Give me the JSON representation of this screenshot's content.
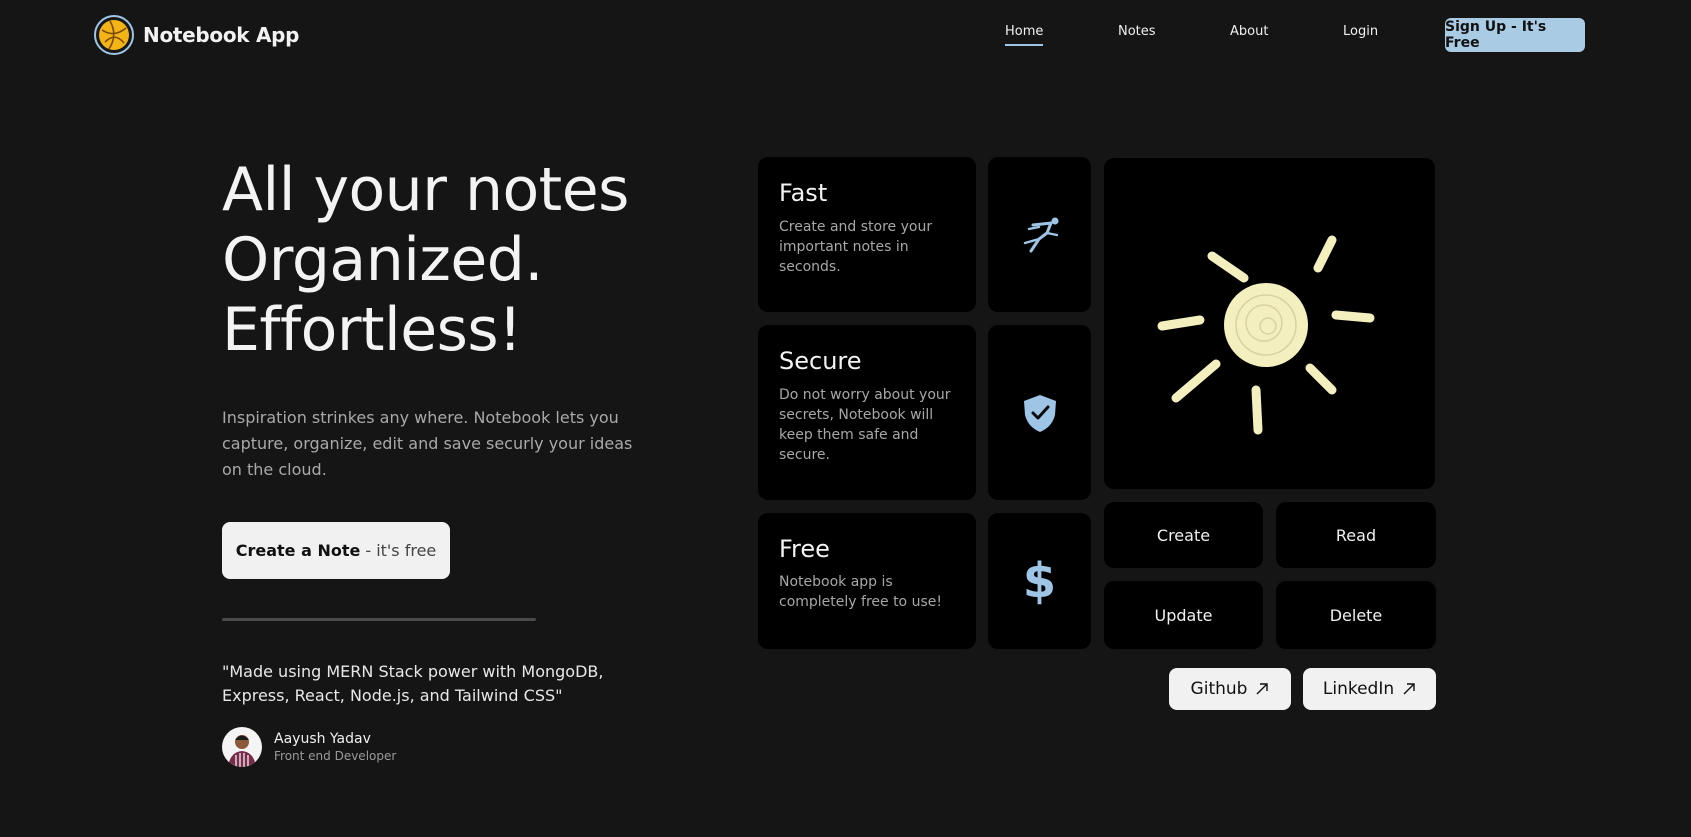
{
  "app": {
    "name": "Notebook App"
  },
  "nav": {
    "items": [
      {
        "label": "Home",
        "active": true
      },
      {
        "label": "Notes",
        "active": false
      },
      {
        "label": "About",
        "active": false
      },
      {
        "label": "Login",
        "active": false
      }
    ],
    "signup_label": "Sign Up - It's Free"
  },
  "hero": {
    "title_lines": [
      "All your notes",
      "Organized.",
      "Effortless!"
    ],
    "description": "Inspiration strinkes any where. Notebook lets you capture, organize, edit and save securly your ideas on the cloud.",
    "cta_strong": "Create a Note",
    "cta_light": "- it's free"
  },
  "quote": {
    "text": "\"Made using MERN Stack power with MongoDB, Express, React, Node.js, and Tailwind CSS\"",
    "author_name": "Aayush Yadav",
    "author_role": "Front end Developer"
  },
  "features": [
    {
      "title": "Fast",
      "text": "Create and store your important notes in seconds.",
      "icon": "running-man-icon"
    },
    {
      "title": "Secure",
      "text": "Do not worry about your secrets, Notebook will keep them safe and secure.",
      "icon": "shield-check-icon"
    },
    {
      "title": "Free",
      "text": "Notebook app is completely free to use!",
      "icon": "dollar-icon"
    }
  ],
  "crud": [
    "Create",
    "Read",
    "Update",
    "Delete"
  ],
  "links": {
    "github": "Github",
    "linkedin": "LinkedIn",
    "icon": "arrow-up-right-icon"
  },
  "colors": {
    "background": "#151515",
    "card": "#000000",
    "accent": "#a9cbe4",
    "icon_blue": "#9ec5e6",
    "sun": "#f3efbf"
  }
}
